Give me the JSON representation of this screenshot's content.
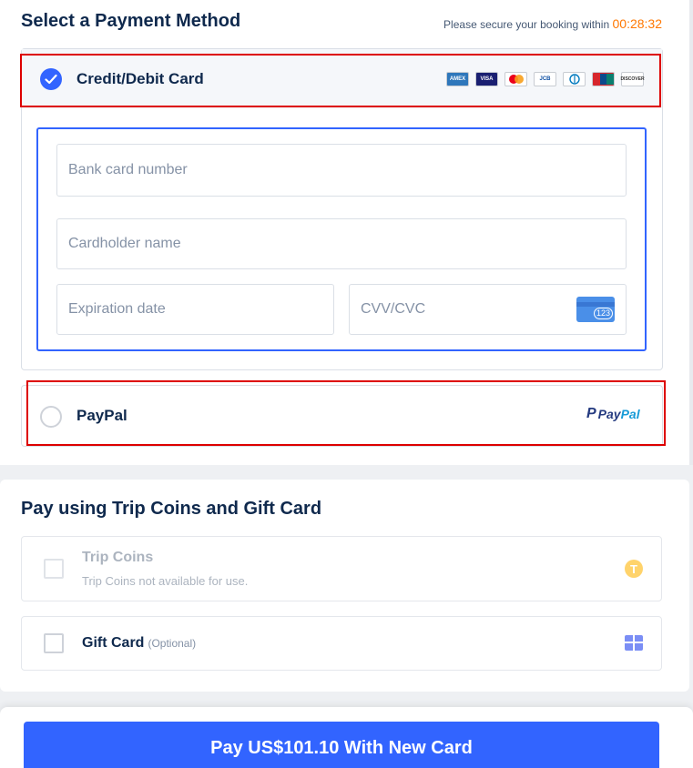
{
  "payment_method": {
    "title": "Select a Payment Method",
    "timer_label": "Please secure your booking within",
    "timer_value": "00:28:32",
    "timer_color": "#ff7700",
    "options": [
      {
        "label": "Credit/Debit Card",
        "selected": true
      },
      {
        "label": "PayPal",
        "selected": false
      }
    ],
    "card_brands": [
      "AMEX",
      "VISA",
      "Mastercard",
      "JCB",
      "Diners Club",
      "UnionPay",
      "DISCOVER"
    ],
    "card_form": {
      "card_number_placeholder": "Bank card number",
      "holder_placeholder": "Cardholder name",
      "expiry_placeholder": "Expiration date",
      "cvv_placeholder": "CVV/CVC",
      "cvv_icon_text": "123"
    },
    "paypal_logo": {
      "p": "P",
      "pay": "Pay",
      "pal": "Pal"
    }
  },
  "extras": {
    "title": "Pay using Trip Coins and Gift Card",
    "trip_coins": {
      "label": "Trip Coins",
      "sub": "Trip Coins not available for use.",
      "icon": "T",
      "enabled": false
    },
    "gift_card": {
      "label": "Gift Card",
      "optional": "(Optional)",
      "enabled": true
    }
  },
  "footer": {
    "pay_label": "Pay US$101.10 With New Card"
  },
  "colors": {
    "accent": "#3264ff",
    "highlight": "#dd0000",
    "text": "#0f294d"
  }
}
